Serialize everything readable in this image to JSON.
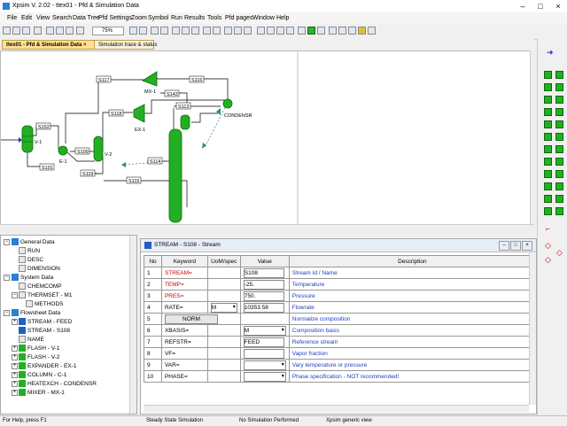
{
  "window": {
    "title": "Xpsim V. 2.02 - ttex01 - Pfd & Simulation Data"
  },
  "menu": [
    "File",
    "Edit",
    "View",
    "Search",
    "Data Tree",
    "Pfd Settings",
    "Zoom",
    "Symbol",
    "Run",
    "Results",
    "Tools",
    "Pfd pages",
    "Window",
    "Help"
  ],
  "toolbar": {
    "zoom": "75%"
  },
  "tabs": {
    "pfd": "ttex01 - Pfd & Simulation Data",
    "trace": "Simulation trace & status"
  },
  "pfd": {
    "streams": [
      "S117",
      "S116",
      "S143",
      "S113",
      "S118",
      "S152",
      "S109",
      "S108",
      "S101",
      "S119",
      "S114",
      "S115"
    ],
    "units": [
      "MX-1",
      "EX-1",
      "V-1",
      "E-1",
      "V-2",
      "CONDENSR"
    ]
  },
  "tree": {
    "items": [
      "General Data",
      "RUN",
      "DESC",
      "DIMENSION",
      "System Data",
      "CHEMCOMP",
      "THERMSET - M1",
      "METHODS",
      "Flowsheet Data",
      "STREAM - FEED",
      "STREAM - S108",
      "NAME",
      "FLASH - V-1",
      "FLASH - V-2",
      "EXPANDER - EX-1",
      "COLUMN - C-1",
      "HEATEXCH - CONDENSR",
      "MIXER - MX-1"
    ]
  },
  "panel": {
    "title": "STREAM - S108 - Stream",
    "columns": [
      "No",
      "Keyword",
      "UoM/spec",
      "Value",
      "Description"
    ],
    "rows": [
      {
        "no": "1",
        "keyword": "STREAM=",
        "uom": "",
        "value": "S108",
        "desc": "Stream Id / Name"
      },
      {
        "no": "2",
        "keyword": "TEMP=",
        "uom": "",
        "value": "-25.",
        "desc": "Temperature"
      },
      {
        "no": "3",
        "keyword": "PRES=",
        "uom": "",
        "value": "750.",
        "desc": "Pressure"
      },
      {
        "no": "4",
        "keyword": "RATE=",
        "uom": "M",
        "value": "10353.58",
        "desc": "Flowrate"
      },
      {
        "no": "5",
        "keyword": "NORM",
        "uom": "",
        "value": "",
        "desc": "Normalize composition"
      },
      {
        "no": "6",
        "keyword": "XBASIS=",
        "uom": "",
        "value": "M",
        "desc": "Composition basis"
      },
      {
        "no": "7",
        "keyword": "REFSTR=",
        "uom": "",
        "value": "FEED",
        "desc": "Reference stream"
      },
      {
        "no": "8",
        "keyword": "VF=",
        "uom": "",
        "value": "",
        "desc": "Vapor fraction"
      },
      {
        "no": "9",
        "keyword": "VAR=",
        "uom": "",
        "value": "",
        "desc": "Vary temperature or pressure"
      },
      {
        "no": "10",
        "keyword": "PHASE=",
        "uom": "",
        "value": "",
        "desc": "Phase specification - NOT recommended!"
      }
    ]
  },
  "status": {
    "help": "For Help, press F1",
    "mode": "Steady State Simulation",
    "sim": "No Simulation Performed",
    "view": "Xpsim generic view"
  },
  "colors": {
    "accent": "#ffe090",
    "equipment": "#22b022",
    "keyword_red": "#d00000",
    "desc_blue": "#2040c0"
  }
}
